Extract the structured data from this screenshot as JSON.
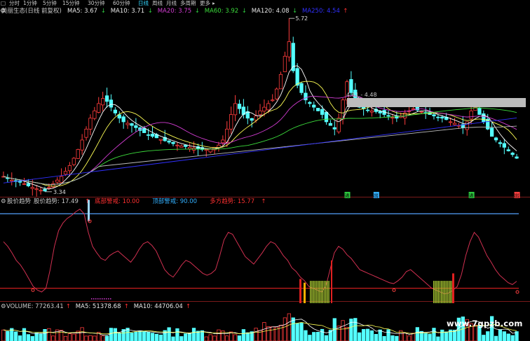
{
  "toolbar": {
    "icon": "square-icon",
    "periods": [
      "分时",
      "1分钟",
      "5分钟",
      "15分钟",
      "30分钟",
      "60分钟",
      "日线",
      "周线",
      "月线",
      "多周期",
      "更多"
    ],
    "active": "日线",
    "more_arrow": "▸"
  },
  "main": {
    "title": "美丽生态(日线 前复权)",
    "ma": [
      {
        "label": "MA5: 3.67",
        "color": "#e8e8e8",
        "arrow": "↓",
        "arrow_color": "#2ecc40"
      },
      {
        "label": "MA10: 3.71",
        "color": "#e8e8e8",
        "arrow": "↓",
        "arrow_color": "#2ecc40"
      },
      {
        "label": "MA20: 3.75",
        "color": "#d23cd2",
        "arrow": "↓",
        "arrow_color": "#2ecc40"
      },
      {
        "label": "MA60: 3.92",
        "color": "#3cdc3c",
        "arrow": "↓",
        "arrow_color": "#2ecc40"
      },
      {
        "label": "MA120: 4.08",
        "color": "#e8e8e8",
        "arrow": "↓",
        "arrow_color": "#2ecc40"
      },
      {
        "label": "MA250: 4.54",
        "color": "#3030ff",
        "arrow": "↑",
        "arrow_color": "#ff3030"
      }
    ],
    "high_label": "5.72",
    "low_label": "3.34",
    "range_label": "4.61 - 4.48",
    "signals": [
      {
        "text": "进",
        "color": "#2ecc40"
      },
      {
        "text": "出",
        "color": "#33b0ff"
      },
      {
        "text": "进",
        "color": "#2ecc40"
      },
      {
        "text": "出",
        "color": "#ff4040"
      }
    ]
  },
  "indicator": {
    "name": "股价趋势",
    "items": [
      {
        "label": "股价趋势: 17.49",
        "color": "#c8c8c8",
        "arrow": "↑",
        "arrow_color": "#ff3030"
      },
      {
        "label": "底部警戒: 10.00",
        "color": "#ff3030"
      },
      {
        "label": "顶部警戒: 90.00",
        "color": "#33b0ff"
      },
      {
        "label": "多方趋势: 15.77",
        "color": "#ff3030",
        "arrow": "↑",
        "arrow_color": "#ff3030"
      }
    ]
  },
  "volume": {
    "items": [
      {
        "label": "VOLUME: 77263.41",
        "color": "#c8c8c8",
        "arrow": "↑",
        "arrow_color": "#ff3030"
      },
      {
        "label": "MA5: 51378.68",
        "color": "#e8e8e8",
        "arrow": "↑",
        "arrow_color": "#ff3030"
      },
      {
        "label": "MA10: 44706.04",
        "color": "#e8e8e8",
        "arrow": "↑",
        "arrow_color": "#ff3030"
      }
    ]
  },
  "watermark": "www.7gpzb.com",
  "chart_data": {
    "type": "candlestick",
    "price_range": [
      3.34,
      5.72
    ],
    "closes": [
      3.55,
      3.52,
      3.5,
      3.48,
      3.47,
      3.45,
      3.42,
      3.4,
      3.38,
      3.36,
      3.35,
      3.4,
      3.45,
      3.5,
      3.55,
      3.62,
      3.7,
      3.8,
      3.92,
      4.05,
      4.2,
      4.35,
      4.45,
      4.55,
      4.62,
      4.58,
      4.5,
      4.42,
      4.35,
      4.3,
      4.28,
      4.25,
      4.22,
      4.18,
      4.15,
      4.12,
      4.1,
      4.08,
      4.06,
      4.04,
      4.02,
      4.0,
      3.98,
      3.97,
      3.96,
      3.95,
      3.94,
      3.93,
      3.92,
      3.92,
      3.93,
      3.95,
      3.98,
      4.05,
      4.2,
      4.4,
      4.55,
      4.48,
      4.4,
      4.35,
      4.32,
      4.38,
      4.45,
      4.5,
      4.55,
      4.6,
      4.75,
      4.95,
      5.2,
      5.4,
      5.0,
      4.8,
      4.7,
      4.6,
      4.55,
      4.5,
      4.45,
      4.4,
      4.3,
      4.25,
      4.2,
      4.35,
      4.6,
      4.85,
      4.7,
      4.55,
      4.5,
      4.48,
      4.46,
      4.45,
      4.44,
      4.42,
      4.4,
      4.38,
      4.36,
      4.35,
      4.38,
      4.42,
      4.45,
      4.48,
      4.46,
      4.44,
      4.42,
      4.4,
      4.38,
      4.36,
      4.35,
      4.33,
      4.3,
      4.28,
      4.25,
      4.22,
      4.3,
      4.45,
      4.5,
      4.4,
      4.3,
      4.2,
      4.1,
      4.05,
      4.0,
      3.95,
      3.9,
      3.85,
      3.8
    ],
    "ma_series": [
      "MA5",
      "MA10",
      "MA20",
      "MA60",
      "MA120",
      "MA250"
    ],
    "indicator_values": [
      60,
      55,
      48,
      40,
      35,
      28,
      20,
      12,
      8,
      6,
      10,
      30,
      55,
      72,
      80,
      85,
      88,
      92,
      95,
      90,
      70,
      55,
      48,
      42,
      40,
      45,
      48,
      50,
      46,
      42,
      38,
      44,
      52,
      58,
      60,
      56,
      50,
      40,
      30,
      25,
      22,
      28,
      35,
      40,
      38,
      34,
      30,
      26,
      24,
      26,
      30,
      45,
      62,
      70,
      68,
      60,
      52,
      44,
      40,
      36,
      42,
      48,
      55,
      60,
      58,
      52,
      45,
      40,
      32,
      28,
      22,
      18,
      12,
      10,
      8,
      6,
      12,
      30,
      48,
      55,
      52,
      46,
      42,
      36,
      30,
      28,
      26,
      24,
      22,
      20,
      18,
      16,
      15,
      18,
      22,
      28,
      30,
      26,
      22,
      18,
      14,
      10,
      8,
      6,
      4,
      5,
      8,
      12,
      25,
      45,
      60,
      70,
      65,
      55,
      45,
      38,
      30,
      24,
      20,
      16,
      14,
      17.49
    ],
    "volume_series": [
      "VOLUME",
      "MA5",
      "MA10"
    ]
  }
}
